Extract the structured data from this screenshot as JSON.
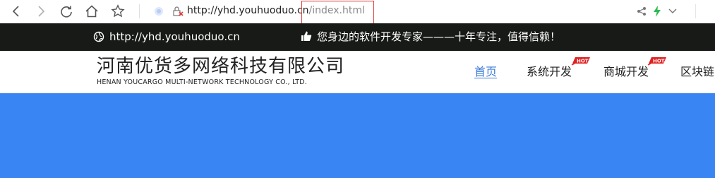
{
  "browser": {
    "url_host": "http://yhd.youhuoduo.cn",
    "url_path": "/index.html",
    "icons": [
      "back-icon",
      "forward-icon",
      "reload-icon",
      "home-icon",
      "star-icon",
      "site-status-icon",
      "insecure-icon",
      "share-icon",
      "lightning-icon",
      "chevron-down-icon"
    ]
  },
  "topbar": {
    "site_url": "http://yhd.youhuoduo.cn",
    "slogan": "您身边的软件开发专家———十年专注，值得信赖！"
  },
  "header": {
    "logo_cn": "河南优货多网络科技有限公司",
    "logo_en": "HENAN YOUCARGO MULTI-NETWORK TECHNOLOGY CO., LTD.",
    "nav": [
      {
        "label": "首页",
        "active": true
      },
      {
        "label": "系统开发",
        "badge": "HOT"
      },
      {
        "label": "商城开发",
        "badge": "HOT"
      },
      {
        "label": "区块链"
      }
    ]
  },
  "colors": {
    "accent": "#3a7bd5",
    "topbar_bg": "#181a17",
    "banner_bg": "#3a85f4",
    "hot_badge": "#e02020"
  }
}
